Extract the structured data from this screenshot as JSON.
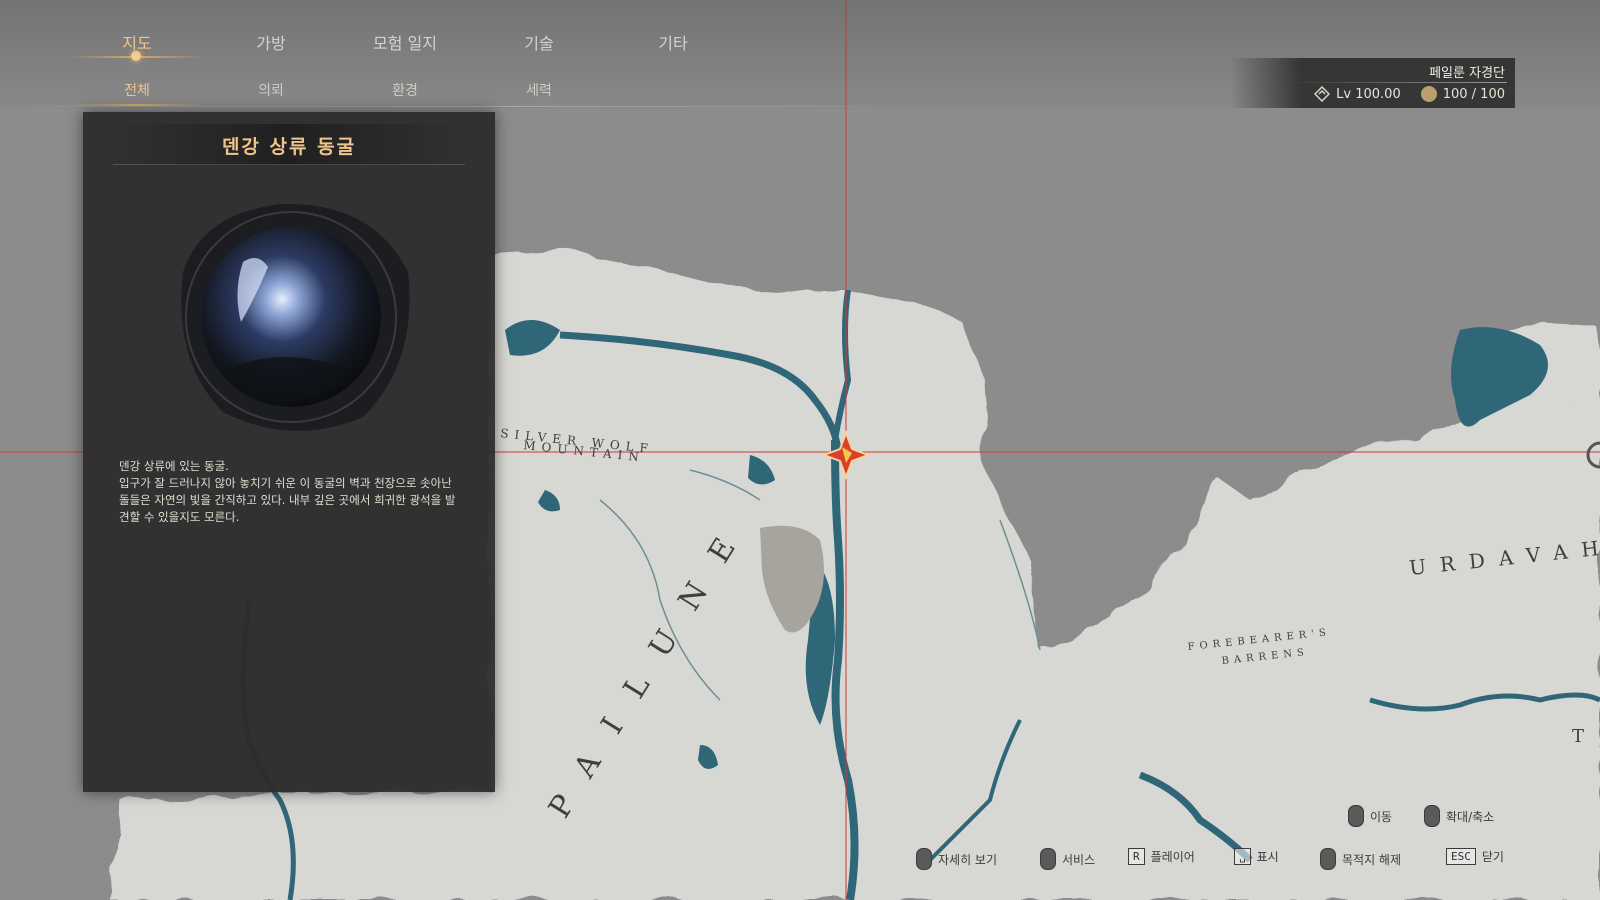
{
  "nav": {
    "main_tabs": [
      {
        "label": "지도",
        "active": true
      },
      {
        "label": "가방",
        "active": false
      },
      {
        "label": "모험 일지",
        "active": false
      },
      {
        "label": "기술",
        "active": false
      },
      {
        "label": "기타",
        "active": false
      }
    ],
    "sub_tabs": [
      {
        "label": "전체",
        "active": true
      },
      {
        "label": "의뢰",
        "active": false
      },
      {
        "label": "환경",
        "active": false
      },
      {
        "label": "세력",
        "active": false
      }
    ]
  },
  "player": {
    "faction": "페일룬 자경단",
    "level": "Lv 100.00",
    "stamina": "100 / 100"
  },
  "location_panel": {
    "title": "덴강 상류 동굴",
    "description": "덴강 상류에 있는 동굴.\n입구가 잘 드러나지 않아 놓치기 쉬운 이 동굴의 벽과 천장으로 솟아난 돌들은 자연의 빛을 간직하고 있다. 내부 깊은 곳에서 희귀한 광석을 발견할 수 있을지도 모른다."
  },
  "map_labels": {
    "silver_wolf_1": "SILVER WOLF",
    "silver_wolf_2": "MOUNTAIN",
    "region_main": "PAILUNE",
    "urdavah": "URDAVAH",
    "forebearers_1": "FOREBEARER'S",
    "forebearers_2": "BARRENS",
    "edge_t": "T"
  },
  "key_hints": {
    "move": "이동",
    "zoom": "확대/축소",
    "details": "자세히 보기",
    "service": "서비스",
    "player_key": "R",
    "player": "플레이어",
    "mark_key": "␣",
    "mark": "표시",
    "waypoint": "목적지 해제",
    "close_key": "ESC",
    "close": "닫기"
  },
  "colors": {
    "accent_gold": "#f2c58a",
    "water": "#2f6678",
    "land": "#d6d6d2",
    "fog": "#8f8f8f",
    "crosshair": "#d23a3a"
  }
}
